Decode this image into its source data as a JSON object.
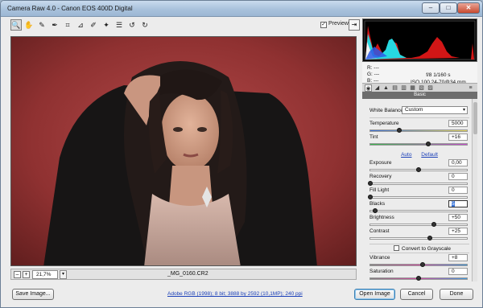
{
  "window": {
    "title": "Camera Raw 4.0  -  Canon EOS 400D Digital",
    "min": "–",
    "max": "□",
    "close": "✕"
  },
  "toolbar": {
    "tools": [
      {
        "name": "zoom-tool",
        "glyph": "🔍"
      },
      {
        "name": "hand-tool",
        "glyph": "✋"
      },
      {
        "name": "white-balance-tool",
        "glyph": "✎"
      },
      {
        "name": "color-sampler-tool",
        "glyph": "✒"
      },
      {
        "name": "crop-tool",
        "glyph": "⌗"
      },
      {
        "name": "straighten-tool",
        "glyph": "⊿"
      },
      {
        "name": "retouch-tool",
        "glyph": "✐"
      },
      {
        "name": "red-eye-tool",
        "glyph": "✦"
      },
      {
        "name": "preferences-tool",
        "glyph": "☰"
      },
      {
        "name": "rotate-left-tool",
        "glyph": "↺"
      },
      {
        "name": "rotate-right-tool",
        "glyph": "↻"
      }
    ],
    "preview_label": "Preview",
    "preview_checked": "✓",
    "fullscreen": "⇥"
  },
  "status": {
    "zoom_out": "–",
    "zoom_in": "+",
    "zoom": "21,7%",
    "zoom_arrow": "▾",
    "filename": "_MG_0160.CR2"
  },
  "info": {
    "r": "R:   ---",
    "g": "G:   ---",
    "b": "B:   ---",
    "aperture_shutter": "f/8      1/160 s",
    "iso_lens": "ISO 100   24-70@34 mm"
  },
  "panel": {
    "section": "Basic",
    "white_balance": {
      "label": "White Balance:",
      "value": "Custom"
    },
    "auto": "Auto",
    "default": "Default",
    "convert_grayscale": "Convert to Grayscale",
    "sliders": [
      {
        "key": "temperature",
        "label": "Temperature",
        "value": "5000",
        "pos": 0.3,
        "gradient": "linear-gradient(90deg,#3a6fd8,#e8d85a)"
      },
      {
        "key": "tint",
        "label": "Tint",
        "value": "+16",
        "pos": 0.6,
        "gradient": "linear-gradient(90deg,#36b84a,#c84ad0)"
      },
      {
        "key": "exposure",
        "label": "Exposure",
        "value": "0,00",
        "pos": 0.5,
        "gradient": "none"
      },
      {
        "key": "recovery",
        "label": "Recovery",
        "value": "0",
        "pos": 0.0,
        "gradient": "none"
      },
      {
        "key": "fill-light",
        "label": "Fill Light",
        "value": "0",
        "pos": 0.0,
        "gradient": "none"
      },
      {
        "key": "blacks",
        "label": "Blacks",
        "value": "5",
        "pos": 0.05,
        "gradient": "none",
        "focus": true
      },
      {
        "key": "brightness",
        "label": "Brightness",
        "value": "+50",
        "pos": 0.66,
        "gradient": "none"
      },
      {
        "key": "contrast",
        "label": "Contrast",
        "value": "+25",
        "pos": 0.62,
        "gradient": "none"
      },
      {
        "key": "vibrance",
        "label": "Vibrance",
        "value": "+8",
        "pos": 0.54,
        "gradient": "linear-gradient(90deg,#7d7d7d,#d24aa0,#3a9be0)"
      },
      {
        "key": "saturation",
        "label": "Saturation",
        "value": "0",
        "pos": 0.5,
        "gradient": "linear-gradient(90deg,#7d7d7d,#d24aa0,#3a9be0)"
      }
    ]
  },
  "footer": {
    "save_image": "Save Image...",
    "workflow": "Adobe RGB (1998); 8 bit; 3888 by 2592 (10,1MP); 240 ppi",
    "open_image": "Open Image",
    "cancel": "Cancel",
    "done": "Done"
  },
  "colors": {
    "backdrop": "#8e2f2f",
    "accent": "#3c7fb1",
    "link": "#1a3fb8"
  }
}
